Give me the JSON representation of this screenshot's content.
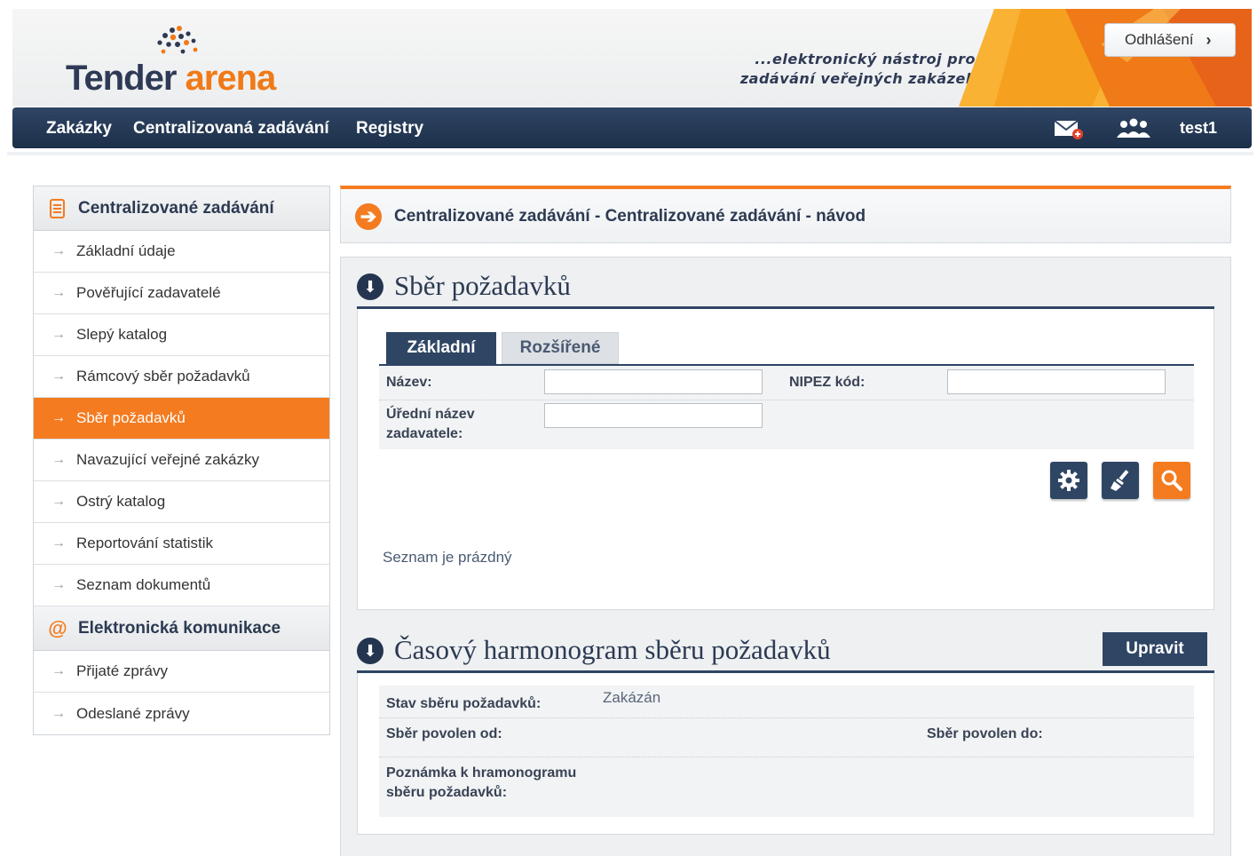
{
  "header": {
    "logo_left": "Tender",
    "logo_right": "arena",
    "tagline_line1": "...elektronický nástroj pro",
    "tagline_line2": "zadávání veřejných zakázek",
    "logout_label": "Odhlášení",
    "colors": {
      "navy": "#2f4564",
      "orange": "#f47b20"
    }
  },
  "nav": {
    "items": [
      "Zakázky",
      "Centralizovaná zadávání",
      "Registry"
    ],
    "user": "test1",
    "icons": [
      "mail-icon",
      "users-icon"
    ]
  },
  "sidebar": {
    "group1": {
      "title": "Centralizované zadávání",
      "items": [
        "Základní údaje",
        "Pověřující zadavatelé",
        "Slepý katalog",
        "Rámcový sběr požadavků",
        "Sběr požadavků",
        "Navazující veřejné zakázky",
        "Ostrý katalog",
        "Reportování statistik",
        "Seznam dokumentů"
      ],
      "active_index": 4
    },
    "group2": {
      "title": "Elektronická komunikace",
      "items": [
        "Přijaté zprávy",
        "Odeslané zprávy"
      ]
    }
  },
  "breadcrumb": "Centralizované zadávání - Centralizované zadávání - návod",
  "section1": {
    "title": "Sběr požadavků",
    "tabs": [
      "Základní",
      "Rozšířené"
    ],
    "fields": {
      "name_label": "Název:",
      "name_value": "",
      "nipez_label": "NIPEZ kód:",
      "nipez_value": "",
      "official_label_line1": "Úřední název",
      "official_label_line2": "zadavatele:",
      "official_value": ""
    },
    "actions": [
      "gear-icon",
      "brush-icon",
      "search-icon"
    ],
    "empty_text": "Seznam je prázdný"
  },
  "section2": {
    "title": "Časový harmonogram sběru požadavků",
    "edit_label": "Upravit",
    "status_label": "Stav sběru požadavků:",
    "status_value": "Zakázán",
    "from_label": "Sběr povolen od:",
    "to_label": "Sběr povolen do:",
    "note_label_line1": "Poznámka k hramonogramu",
    "note_label_line2": "sběru požadavků:"
  }
}
